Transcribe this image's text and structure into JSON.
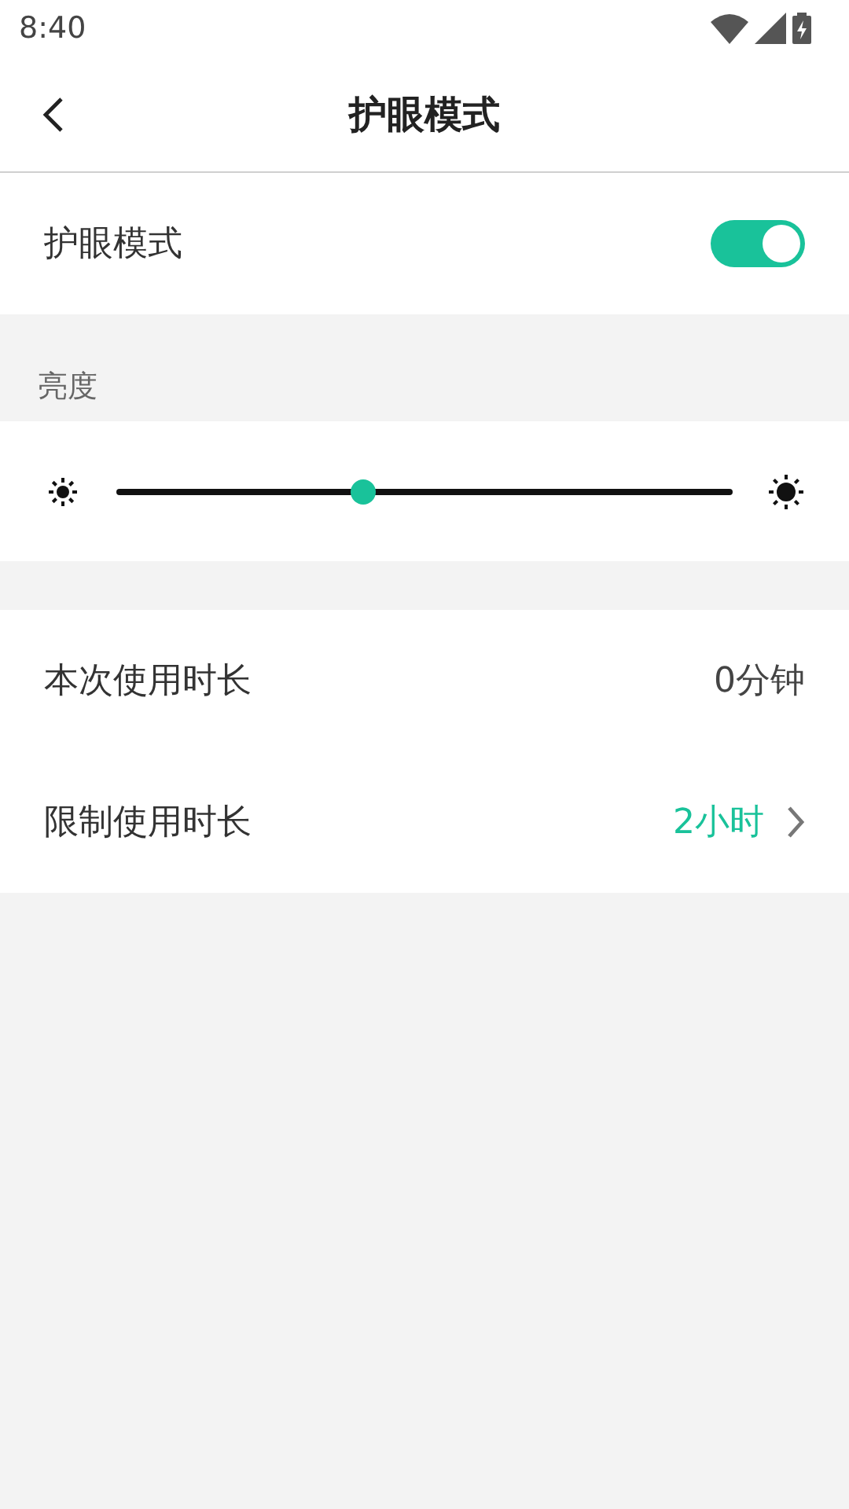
{
  "status_bar": {
    "time": "8:40"
  },
  "header": {
    "title": "护眼模式"
  },
  "eye_mode": {
    "label": "护眼模式",
    "on": true
  },
  "brightness": {
    "label": "亮度",
    "level": 0.4
  },
  "rows": [
    {
      "label": "本次使用时长",
      "value": "0分钟",
      "kind": "plain"
    },
    {
      "label": "限制使用时长",
      "value": "2小时",
      "kind": "link"
    }
  ]
}
